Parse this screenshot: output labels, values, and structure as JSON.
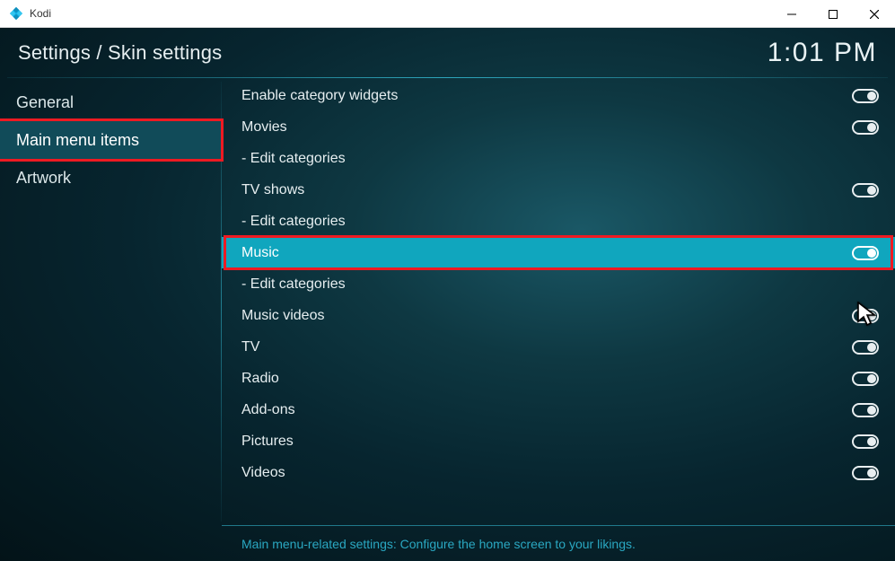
{
  "window": {
    "title": "Kodi"
  },
  "header": {
    "breadcrumb": "Settings / Skin settings",
    "clock": "1:01 PM"
  },
  "sidebar": {
    "items": [
      {
        "label": "General",
        "active": false,
        "highlight": false
      },
      {
        "label": "Main menu items",
        "active": true,
        "highlight": true
      },
      {
        "label": "Artwork",
        "active": false,
        "highlight": false
      }
    ]
  },
  "settings": [
    {
      "label": "Enable category widgets",
      "toggle": "on",
      "indent": false
    },
    {
      "label": "Movies",
      "toggle": "on",
      "indent": false
    },
    {
      "label": "- Edit categories",
      "toggle": null,
      "indent": true
    },
    {
      "label": "TV shows",
      "toggle": "on",
      "indent": false
    },
    {
      "label": "- Edit categories",
      "toggle": null,
      "indent": true
    },
    {
      "label": "Music",
      "toggle": "on",
      "indent": false,
      "selected": true,
      "highlight": true
    },
    {
      "label": "- Edit categories",
      "toggle": null,
      "indent": true
    },
    {
      "label": "Music videos",
      "toggle": "on",
      "indent": false
    },
    {
      "label": "TV",
      "toggle": "on",
      "indent": false
    },
    {
      "label": "Radio",
      "toggle": "on",
      "indent": false
    },
    {
      "label": "Add-ons",
      "toggle": "on",
      "indent": false
    },
    {
      "label": "Pictures",
      "toggle": "on",
      "indent": false
    },
    {
      "label": "Videos",
      "toggle": "on",
      "indent": false
    }
  ],
  "footer": {
    "help": "Main menu-related settings: Configure the home screen to your likings."
  }
}
